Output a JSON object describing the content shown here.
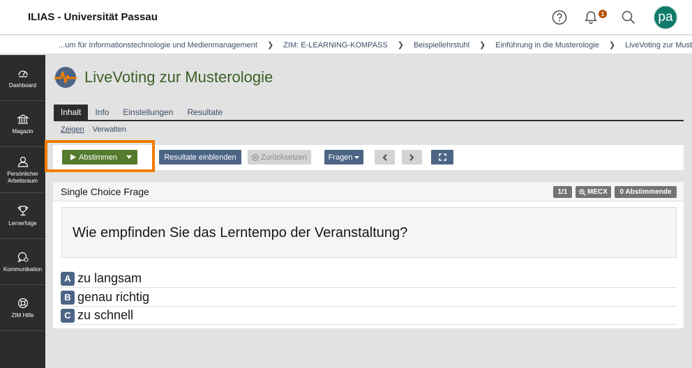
{
  "header": {
    "app_title": "ILIAS - Universität Passau",
    "notification_count": "1",
    "avatar_initials": "pa",
    "icons": [
      "help-icon",
      "bell-icon",
      "search-icon"
    ]
  },
  "breadcrumb": [
    "...um für Informationstechnologie und Medienmanagement",
    "ZIM: E-LEARNING-KOMPASS",
    "Beispiellehrstuhl",
    "Einführung in die Musterologie",
    "LiveVoting zur Musterologie"
  ],
  "sidebar": {
    "items": [
      {
        "label": "Dashboard",
        "icon": "dashboard-icon"
      },
      {
        "label": "Magazin",
        "icon": "library-icon"
      },
      {
        "label": "Persönlicher Arbeitsraum",
        "icon": "user-icon"
      },
      {
        "label": "Lernerfolge",
        "icon": "trophy-icon"
      },
      {
        "label": "Kommunikation",
        "icon": "chat-icon"
      },
      {
        "label": "ZIM Hilfe",
        "icon": "lifebuoy-icon"
      }
    ]
  },
  "page": {
    "title": "LiveVoting zur Musterologie",
    "tabs": [
      {
        "label": "Inhalt",
        "active": true
      },
      {
        "label": "Info",
        "active": false
      },
      {
        "label": "Einstellungen",
        "active": false
      },
      {
        "label": "Resultate",
        "active": false
      }
    ],
    "subtabs": [
      {
        "label": "Zeigen",
        "active": true
      },
      {
        "label": "Verwalten",
        "active": false
      }
    ]
  },
  "toolbar": {
    "vote_label": "Abstimmen",
    "show_results_label": "Resultate einblenden",
    "reset_label": "Zurücksetzen",
    "questions_label": "Fragen"
  },
  "question": {
    "type": "Single Choice Frage",
    "badge_position": "1/1",
    "badge_code": "MECX",
    "badge_voters": "0 Abstimmende",
    "text": "Wie empfinden Sie das Lerntempo der Veranstaltung?",
    "options": [
      {
        "letter": "A",
        "text": "zu langsam"
      },
      {
        "letter": "B",
        "text": "genau richtig"
      },
      {
        "letter": "C",
        "text": "zu schnell"
      }
    ]
  },
  "colors": {
    "accent_green": "#557b2e",
    "title_green": "#3b5f26",
    "button_blue": "#4c6586",
    "highlight_orange": "#f07d00",
    "sidebar_dark": "#2c2c2c"
  }
}
